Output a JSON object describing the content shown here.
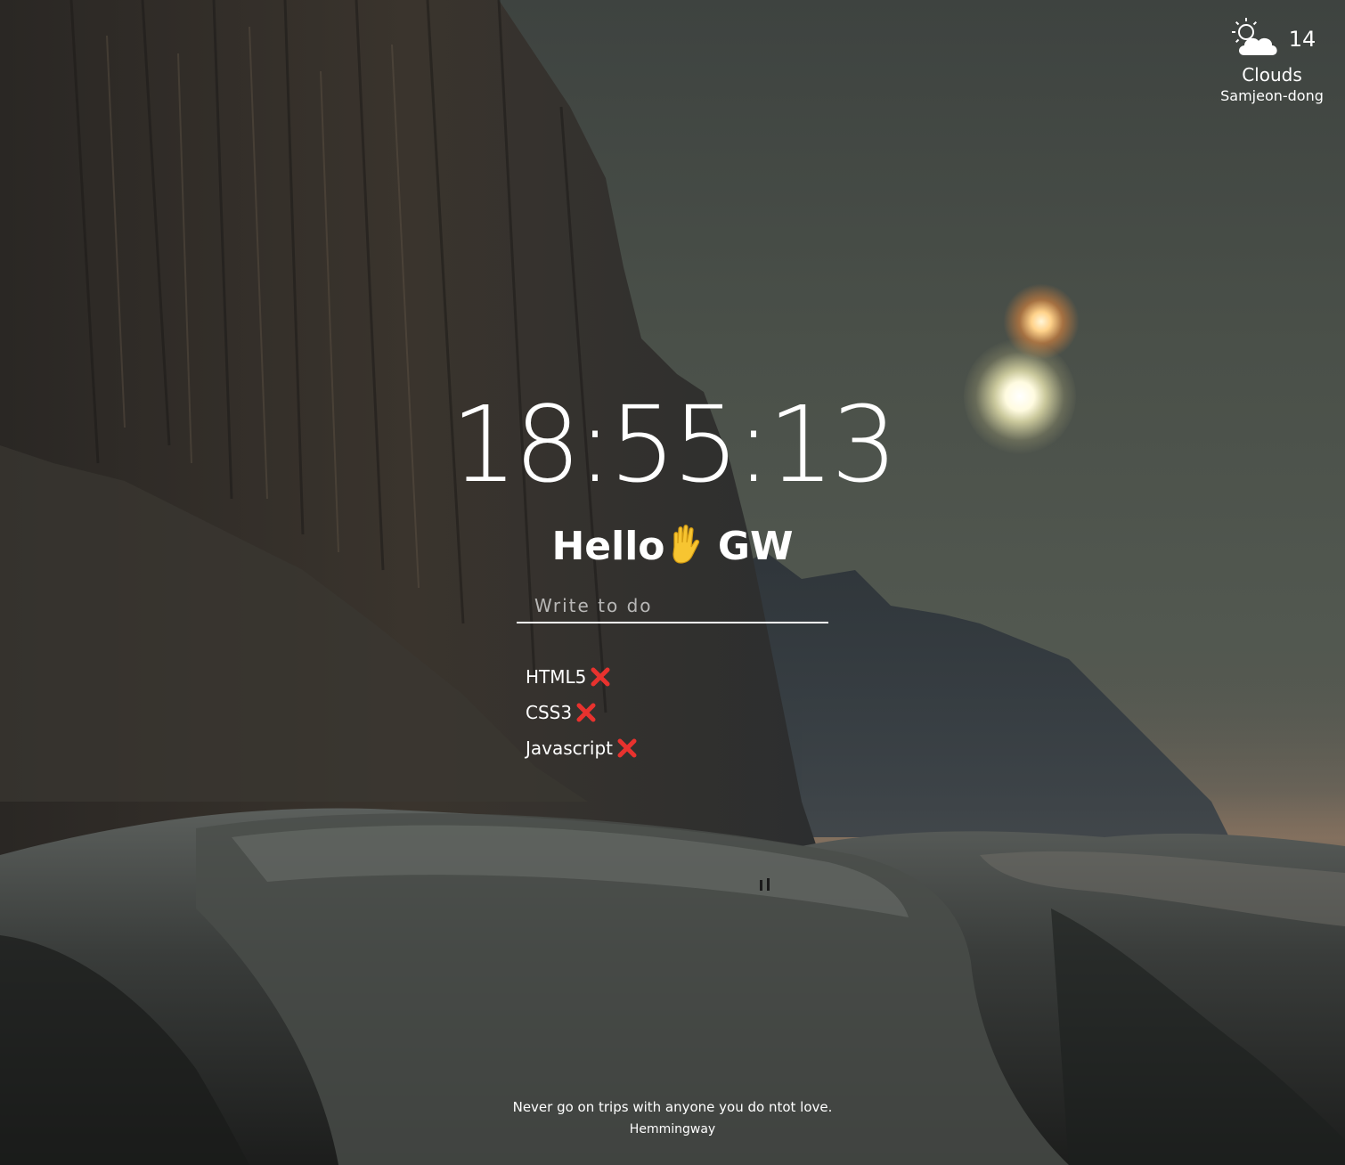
{
  "weather": {
    "icon": "sun-behind-cloud-icon",
    "temperature": "14",
    "description": "Clouds",
    "city": "Samjeon-dong"
  },
  "clock": {
    "time": "18:55:13"
  },
  "greeting": {
    "text": "Hello",
    "name": "GW",
    "emoji": "raised-hand-icon"
  },
  "todo": {
    "placeholder": "Write to do",
    "items": [
      {
        "text": "HTML5"
      },
      {
        "text": "CSS3"
      },
      {
        "text": "Javascript"
      }
    ],
    "delete_icon": "cross-mark-icon",
    "delete_color": "#e8322e"
  },
  "quote": {
    "text": "Never go on trips with anyone you do ntot love.",
    "author": "Hemmingway"
  }
}
